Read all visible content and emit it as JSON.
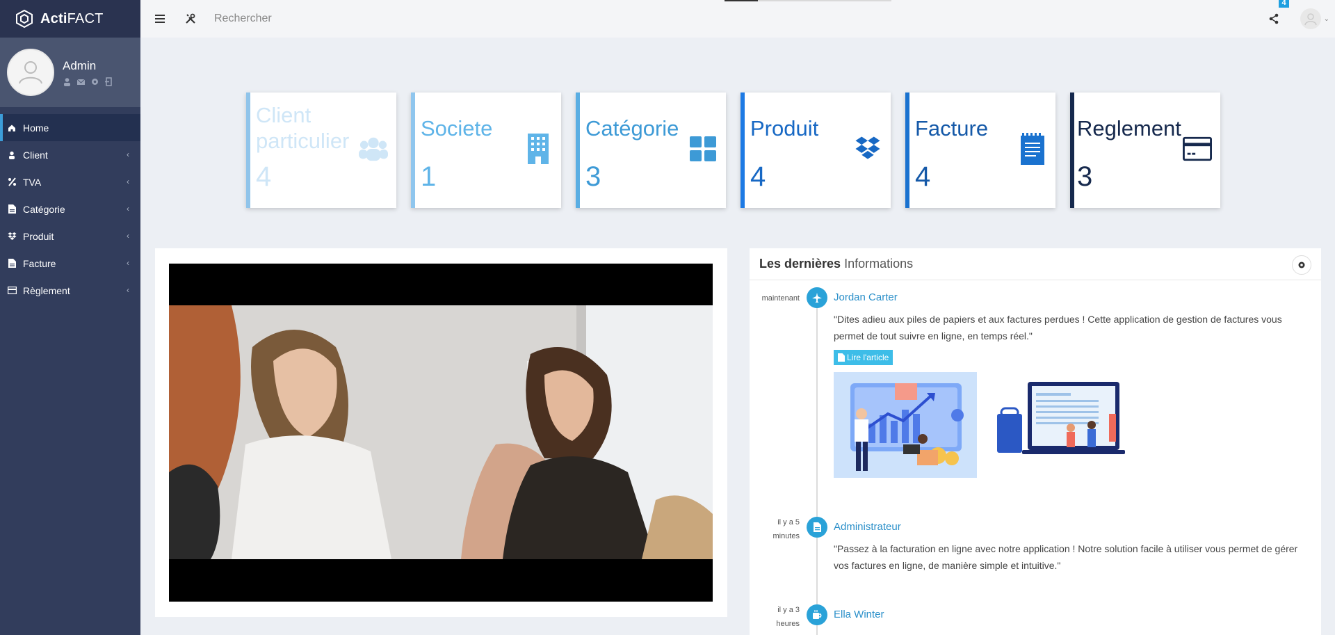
{
  "brand": {
    "name_bold": "Acti",
    "name_rest": "FACT"
  },
  "user": {
    "name": "Admin"
  },
  "sidebar": {
    "items": [
      {
        "label": "Home",
        "icon": "home-icon"
      },
      {
        "label": "Client",
        "icon": "user-icon"
      },
      {
        "label": "TVA",
        "icon": "percent-icon"
      },
      {
        "label": "Catégorie",
        "icon": "file-icon"
      },
      {
        "label": "Produit",
        "icon": "dropbox-icon"
      },
      {
        "label": "Facture",
        "icon": "file-icon"
      },
      {
        "label": "Règlement",
        "icon": "credit-card-icon"
      }
    ]
  },
  "topbar": {
    "search_placeholder": "Rechercher",
    "notification_count": "4"
  },
  "cards": [
    {
      "title": "Client particulier",
      "value": "4",
      "icon": "users-icon",
      "color": "#cfe6f7",
      "border": "#90c4ea"
    },
    {
      "title": "Societe",
      "value": "1",
      "icon": "building-icon",
      "color": "#5fb4e8",
      "border": "#5fb4e8"
    },
    {
      "title": "Catégorie",
      "value": "3",
      "icon": "grid-icon",
      "color": "#3d9ad6",
      "border": "#3d9ad6"
    },
    {
      "title": "Produit",
      "value": "4",
      "icon": "dropbox-icon",
      "color": "#1768c4",
      "border": "#1d7ae4"
    },
    {
      "title": "Facture",
      "value": "4",
      "icon": "document-icon",
      "color": "#1559a8",
      "border": "#1a72cf"
    },
    {
      "title": "Reglement",
      "value": "3",
      "icon": "credit-card-icon",
      "color": "#16294d",
      "border": "#16294d"
    }
  ],
  "timeline": {
    "header_bold": "Les dernières",
    "header_rest": "Informations",
    "items": [
      {
        "time": "maintenant",
        "name": "Jordan Carter",
        "icon": "plane-icon",
        "text": "\"Dites adieu aux piles de papiers et aux factures perdues ! Cette application de gestion de factures vous permet de tout suivre en ligne, en temps réel.\"",
        "button": "Lire l'article"
      },
      {
        "time": "il y a 5 minutes",
        "name": "Administrateur",
        "icon": "document-icon",
        "text": "\"Passez à la facturation en ligne avec notre application ! Notre solution facile à utiliser vous permet de gérer vos factures en ligne, de manière simple et intuitive.\""
      },
      {
        "time": "il y a 3 heures",
        "name": "Ella Winter",
        "icon": "coffee-icon"
      }
    ]
  }
}
